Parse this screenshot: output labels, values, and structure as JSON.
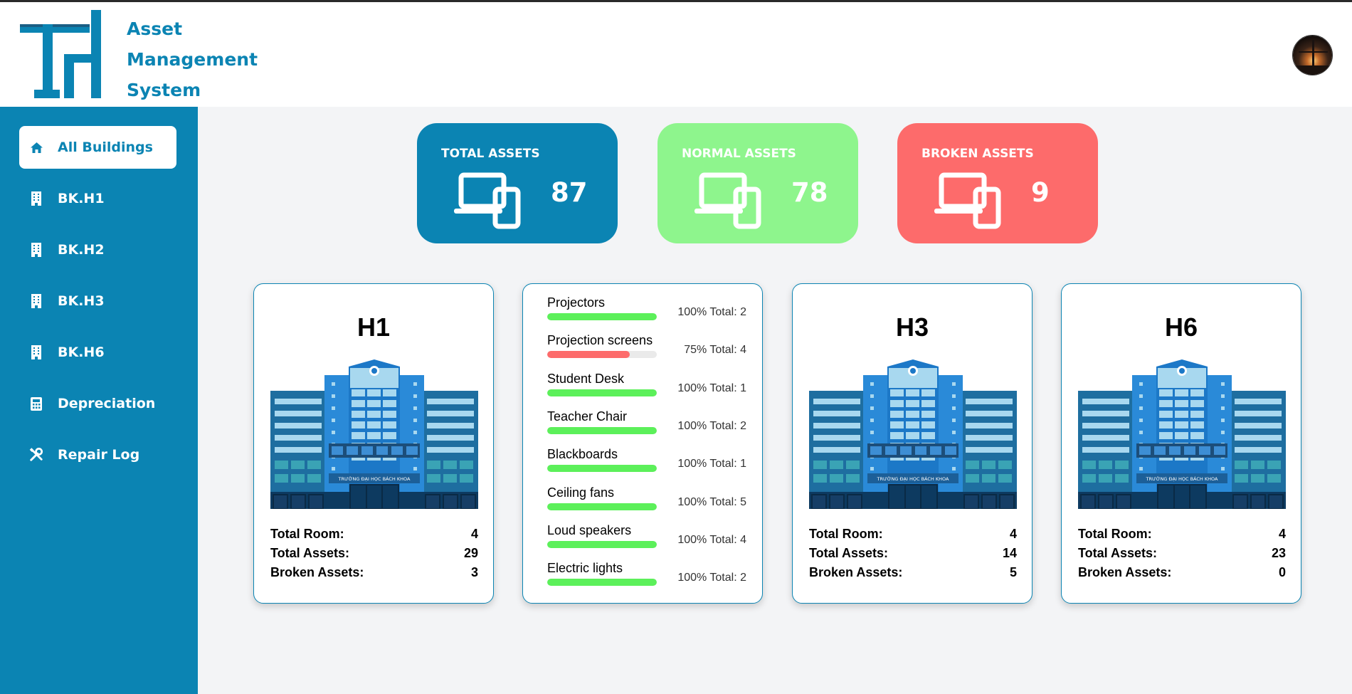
{
  "app": {
    "title_lines": [
      "Asset",
      "Management",
      "System"
    ]
  },
  "sidebar": {
    "items": [
      {
        "label": "All Buildings",
        "icon": "home-icon",
        "active": true
      },
      {
        "label": "BK.H1",
        "icon": "building-icon"
      },
      {
        "label": "BK.H2",
        "icon": "building-icon"
      },
      {
        "label": "BK.H3",
        "icon": "building-icon"
      },
      {
        "label": "BK.H6",
        "icon": "building-icon"
      },
      {
        "label": "Depreciation",
        "icon": "calculator-icon"
      },
      {
        "label": "Repair Log",
        "icon": "tools-icon"
      }
    ]
  },
  "summary": {
    "total": {
      "label": "TOTAL ASSETS",
      "value": "87",
      "color": "#0b84b3"
    },
    "normal": {
      "label": "NORMAL ASSETS",
      "value": "78",
      "color": "#8ef58d"
    },
    "broken": {
      "label": "BROKEN ASSETS",
      "value": "9",
      "color": "#fd6b6b"
    }
  },
  "buildings": [
    {
      "name": "H1",
      "total_room_label": "Total Room:",
      "total_room": "4",
      "total_assets_label": "Total Assets:",
      "total_assets": "29",
      "broken_label": "Broken Assets:",
      "broken": "3"
    },
    {
      "name": "H3",
      "total_room_label": "Total Room:",
      "total_room": "4",
      "total_assets_label": "Total Assets:",
      "total_assets": "14",
      "broken_label": "Broken Assets:",
      "broken": "5"
    },
    {
      "name": "H6",
      "total_room_label": "Total Room:",
      "total_room": "4",
      "total_assets_label": "Total Assets:",
      "total_assets": "23",
      "broken_label": "Broken Assets:",
      "broken": "0"
    }
  ],
  "building_banner_text": "TRƯỜNG ĐẠI HỌC BÁCH KHOA",
  "asset_breakdown": [
    {
      "name": "Projectors",
      "percent": 100,
      "info": "100% Total: 2",
      "color": "#5cf05a"
    },
    {
      "name": "Projection screens",
      "percent": 75,
      "info": "75% Total: 4",
      "color": "#fd6b6b"
    },
    {
      "name": "Student Desk",
      "percent": 100,
      "info": "100% Total: 1",
      "color": "#5cf05a"
    },
    {
      "name": "Teacher Chair",
      "percent": 100,
      "info": "100% Total: 2",
      "color": "#5cf05a"
    },
    {
      "name": "Blackboards",
      "percent": 100,
      "info": "100% Total: 1",
      "color": "#5cf05a"
    },
    {
      "name": "Ceiling fans",
      "percent": 100,
      "info": "100% Total: 5",
      "color": "#5cf05a"
    },
    {
      "name": "Loud speakers",
      "percent": 100,
      "info": "100% Total: 4",
      "color": "#5cf05a"
    },
    {
      "name": "Electric lights",
      "percent": 100,
      "info": "100% Total: 2",
      "color": "#5cf05a"
    }
  ]
}
